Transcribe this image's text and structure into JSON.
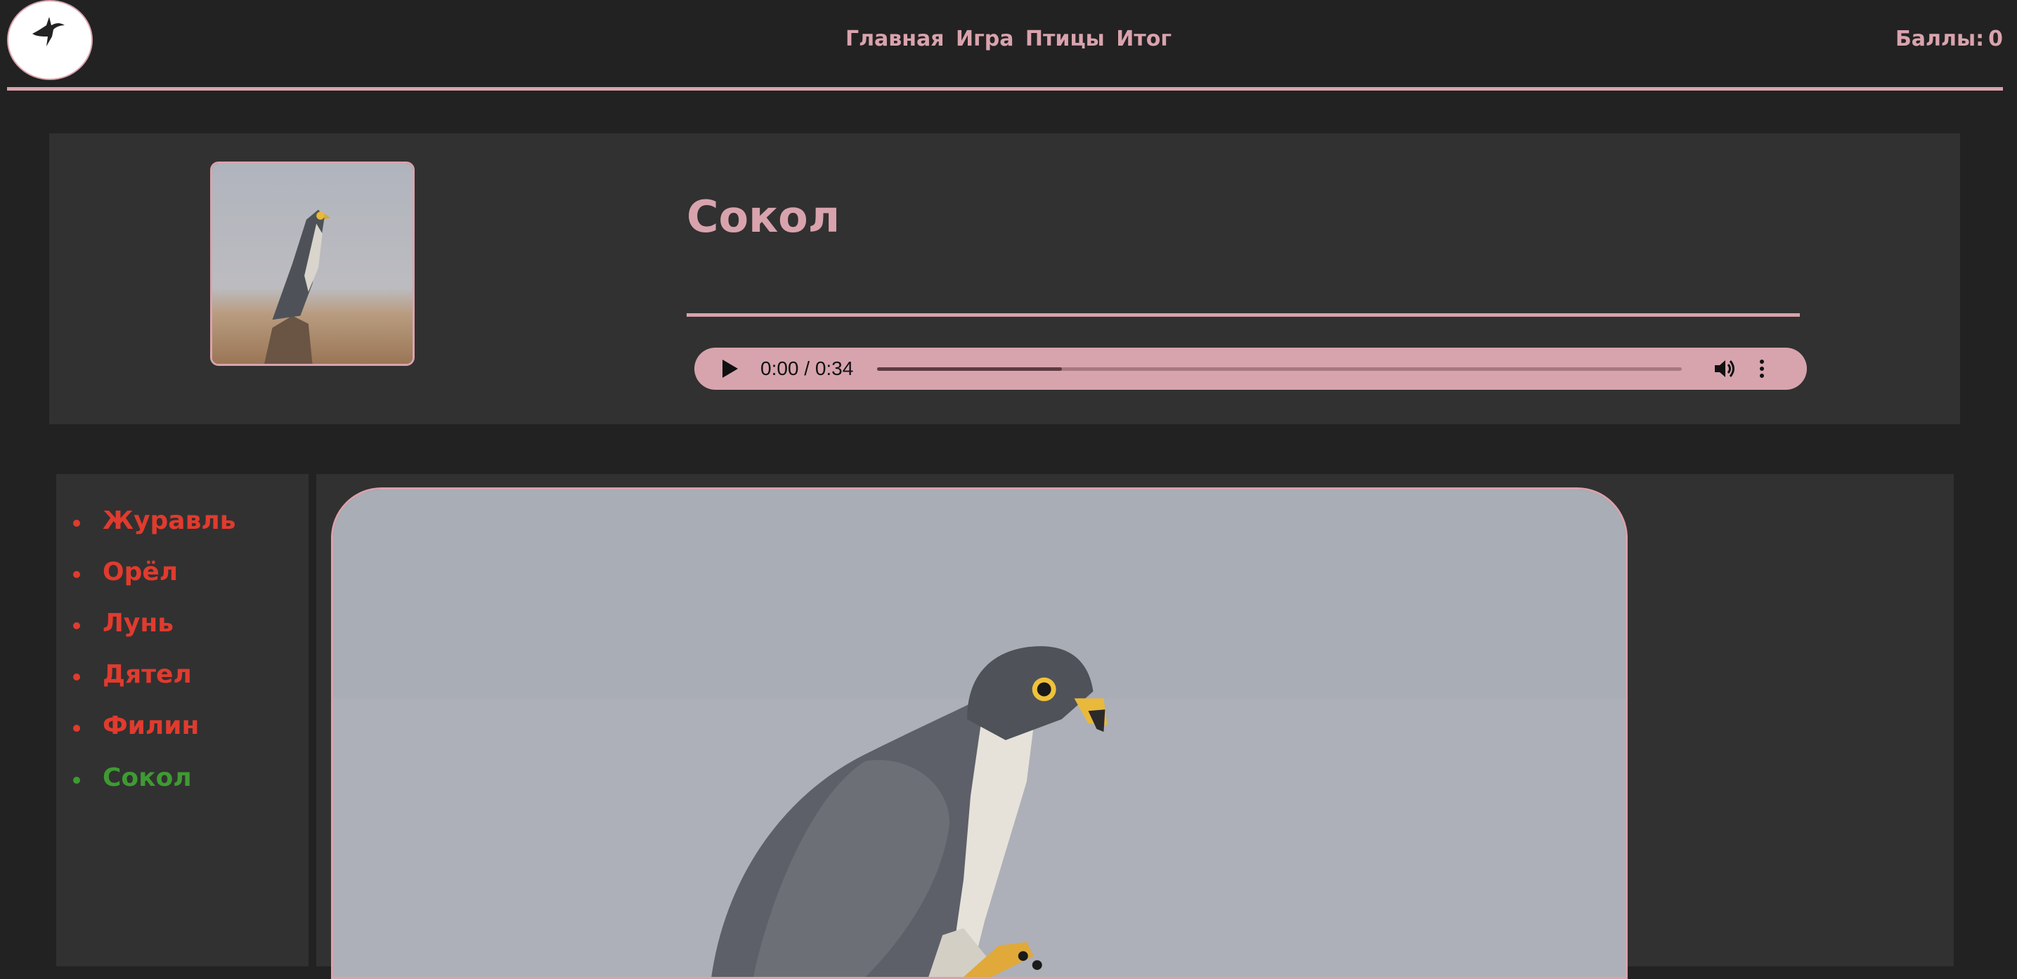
{
  "header": {
    "logo_icon": "hummingbird-icon",
    "nav": [
      "Главная",
      "Игра",
      "Птицы",
      "Итог"
    ],
    "score_label": "Баллы:",
    "score_value": "0"
  },
  "question": {
    "bird_name": "Сокол",
    "thumbnail_icon": "falcon-photo",
    "audio": {
      "time": "0:00 / 0:34",
      "progress_fraction": 0.23,
      "play_icon": "play-icon",
      "volume_icon": "volume-icon",
      "more_icon": "more-vertical-icon"
    }
  },
  "answers": [
    {
      "label": "Журавль",
      "status": "wrong"
    },
    {
      "label": "Орёл",
      "status": "wrong"
    },
    {
      "label": "Лунь",
      "status": "wrong"
    },
    {
      "label": "Дятел",
      "status": "wrong"
    },
    {
      "label": "Филин",
      "status": "wrong"
    },
    {
      "label": "Сокол",
      "status": "correct"
    }
  ],
  "colors": {
    "accent": "#d9a3ad",
    "background": "#222222",
    "panel": "#313131",
    "wrong": "#e03b2e",
    "correct": "#3f9a33"
  }
}
